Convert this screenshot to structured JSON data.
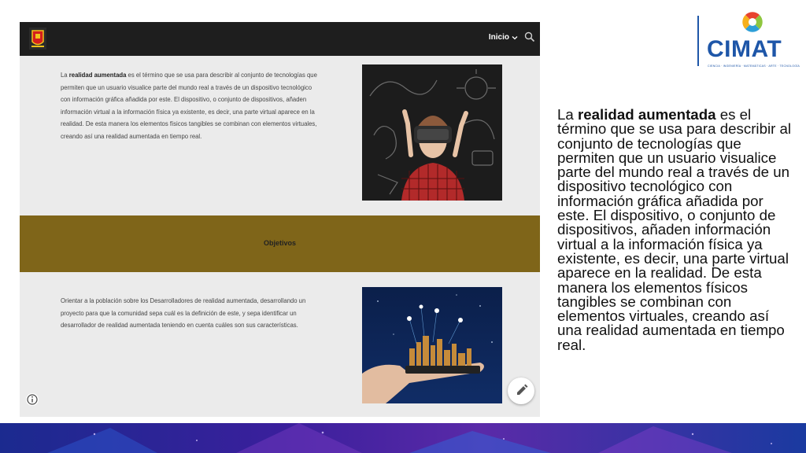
{
  "site": {
    "nav_label": "Inicio",
    "intro": {
      "prefix": "La ",
      "bold": "realidad aumentada",
      "rest": " es el término que se usa para describir al conjunto de tecnologías que permiten que un usuario visualice parte del mundo real a través de un dispositivo tecnológico con información gráfica añadida por este. El dispositivo, o conjunto de dispositivos, añaden información virtual a la información física ya existente, es decir, una parte virtual aparece en la realidad. De esta manera los elementos físicos tangibles se combinan con elementos virtuales, creando así una realidad aumentada en tiempo real."
    },
    "band_title": "Objetivos",
    "objective": "Orientar a la población sobre los Desarrolladores de realidad aumentada, desarrollando un proyecto para que la comunidad sepa cuál es la definición de este, y sepa identificar un desarrollador de realidad aumentada teniendo en cuenta cuáles son sus características.",
    "colors": {
      "topbar": "#1e1e1e",
      "band": "#7f6519",
      "background": "#ebebeb"
    },
    "icons": [
      "chevron-down-icon",
      "search-icon",
      "info-icon",
      "pencil-icon"
    ]
  },
  "logo": {
    "name": "CIMAT",
    "tagline": "CIENCIA · INGENIERÍA · MATEMÁTICAS · ARTE · TECNOLOGÍA",
    "color": "#1e56a8"
  },
  "slide": {
    "prefix": "La ",
    "bold": "realidad aumentada",
    "rest": " es el término que se usa para describir al conjunto de tecnologías que permiten que un usuario visualice parte del mundo real a través de un dispositivo tecnológico con información gráfica añadida por este. El dispositivo, o conjunto de dispositivos, añaden información virtual a la información física ya existente, es decir, una parte virtual aparece en la realidad. De esta manera los elementos físicos tangibles se combinan con elementos virtuales, creando así una realidad aumentada en tiempo real."
  }
}
